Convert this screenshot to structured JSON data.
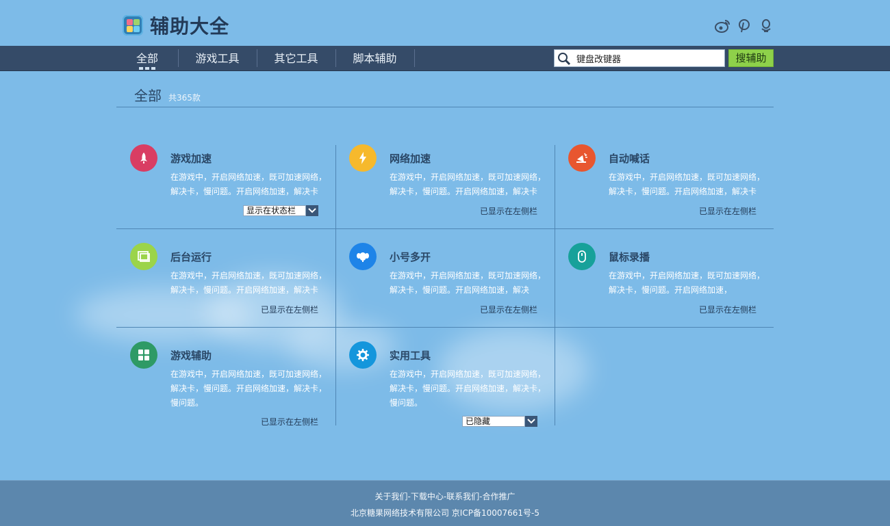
{
  "header": {
    "logo_text": "辅助大全",
    "social": [
      "weibo-icon",
      "pinterest-icon",
      "qq-icon"
    ]
  },
  "nav": {
    "tabs": [
      {
        "label": "全部",
        "active": true
      },
      {
        "label": "游戏工具"
      },
      {
        "label": "其它工具"
      },
      {
        "label": "脚本辅助"
      }
    ],
    "search_value": "键盘改键器",
    "search_button": "搜辅助"
  },
  "section": {
    "title": "全部",
    "count": "共365款"
  },
  "cards": [
    {
      "title": "游戏加速",
      "icon": "rocket-icon",
      "color": "#d93d63",
      "desc": "在游戏中，开启网络加速，既可加速网络，解决卡，慢问题。开启网络加速，解决卡",
      "status": "显示在状态栏",
      "status_type": "select"
    },
    {
      "title": "网络加速",
      "icon": "lightning-icon",
      "color": "#f6b92c",
      "desc": "在游戏中，开启网络加速，既可加速网络，解决卡，慢问题。开启网络加速，解决卡",
      "status": "已显示在左侧栏",
      "status_type": "text"
    },
    {
      "title": "自动喊话",
      "icon": "megaphone-icon",
      "color": "#e8562f",
      "desc": "在游戏中，开启网络加速，既可加速网络，解决卡，慢问题。开启网络加速，解决卡",
      "status": "已显示在左侧栏",
      "status_type": "text"
    },
    {
      "title": "后台运行",
      "icon": "window-icon",
      "color": "#9bd44a",
      "desc": "在游戏中，开启网络加速，既可加速网络，解决卡，慢问题。开启网络加速，解决卡",
      "status": "已显示在左侧栏",
      "status_type": "text"
    },
    {
      "title": "小号多开",
      "icon": "elephant-icon",
      "color": "#1e84e8",
      "desc": "在游戏中，开启网络加速，既可加速网络，解决卡，慢问题。开启网络加速，解决",
      "status": "已显示在左侧栏",
      "status_type": "text"
    },
    {
      "title": "鼠标录播",
      "icon": "mouse-icon",
      "color": "#17a19a",
      "desc": "在游戏中，开启网络加速，既可加速网络，解决卡，慢问题。开启网络加速，",
      "status": "已显示在左侧栏",
      "status_type": "text"
    },
    {
      "title": "游戏辅助",
      "icon": "grid-icon",
      "color": "#2e9a66",
      "desc": "在游戏中，开启网络加速，既可加速网络，解决卡，慢问题。开启网络加速，解决卡，慢问题。",
      "status": "已显示在左侧栏",
      "status_type": "text"
    },
    {
      "title": "实用工具",
      "icon": "gear-icon",
      "color": "#1496dc",
      "desc": "在游戏中，开启网络加速，既可加速网络，解决卡，慢问题。开启网络加速，解决卡，慢问题。",
      "status": "已隐藏",
      "status_type": "select"
    }
  ],
  "footer": {
    "links": "关于我们-下载中心-联系我们-合作推广",
    "copyright": "北京糖果网络技术有限公司 京ICP备10007661号-5"
  }
}
